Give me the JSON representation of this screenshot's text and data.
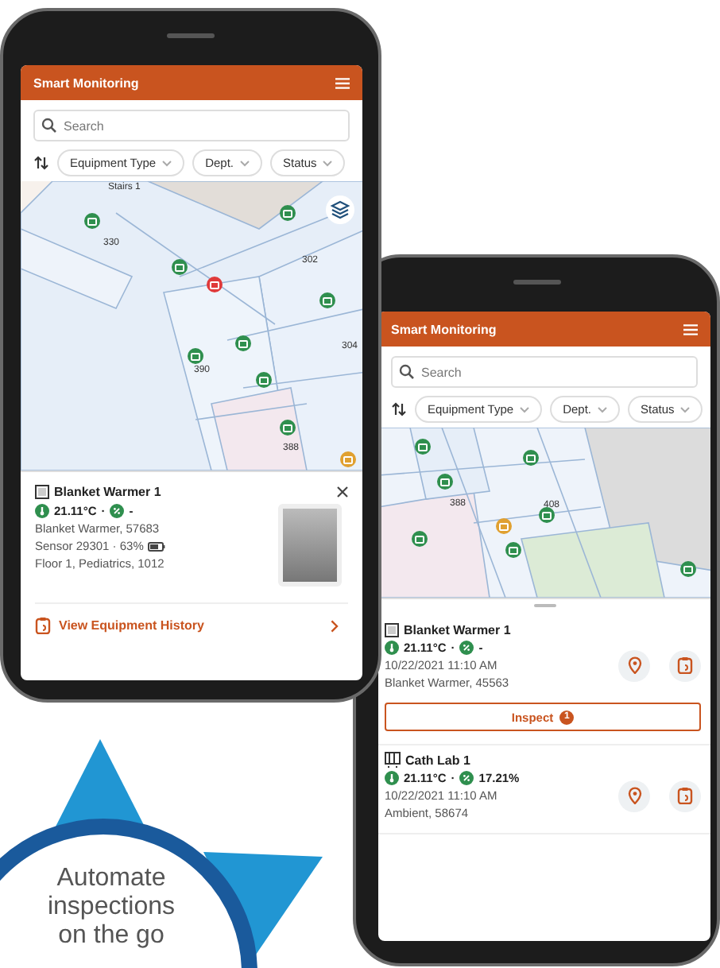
{
  "phones": [
    {
      "app_title": "Smart Monitoring",
      "search": {
        "placeholder": "Search"
      },
      "filters": [
        "Equipment Type",
        "Dept.",
        "Status"
      ],
      "map": {
        "labels": [
          "Stairs 1",
          "330",
          "302",
          "304",
          "390",
          "388"
        ],
        "markers": [
          {
            "color": "#2f8f4e"
          },
          {
            "color": "#2f8f4e"
          },
          {
            "color": "#2f8f4e"
          },
          {
            "color": "#e03a3a"
          },
          {
            "color": "#2f8f4e"
          },
          {
            "color": "#2f8f4e"
          },
          {
            "color": "#2f8f4e"
          },
          {
            "color": "#2f8f4e"
          },
          {
            "color": "#2f8f4e"
          },
          {
            "color": "#e0a030"
          }
        ]
      },
      "detail_card": {
        "name": "Blanket Warmer 1",
        "temperature": "21.11°C",
        "separator": "·",
        "humidity": "-",
        "lines": [
          {
            "kind": "plain",
            "text": "Blanket Warmer, 57683"
          },
          {
            "kind": "battery",
            "text": "Sensor 29301 · 63%"
          },
          {
            "kind": "plain",
            "text": "Floor 1, Pediatrics, 1012"
          }
        ],
        "link": "View Equipment History"
      }
    },
    {
      "app_title": "Smart Monitoring",
      "search": {
        "placeholder": "Search"
      },
      "filters": [
        "Equipment Type",
        "Dept.",
        "Status"
      ],
      "map": {
        "labels": [
          "388",
          "408"
        ],
        "markers": [
          {
            "color": "#2f8f4e"
          },
          {
            "color": "#2f8f4e"
          },
          {
            "color": "#2f8f4e"
          },
          {
            "color": "#2f8f4e"
          },
          {
            "color": "#e0a030"
          },
          {
            "color": "#2f8f4e"
          },
          {
            "color": "#2f8f4e"
          },
          {
            "color": "#2f8f4e"
          }
        ]
      },
      "list": [
        {
          "name": "Blanket Warmer 1",
          "temperature": "21.11°C",
          "separator": "·",
          "humidity": "-",
          "time": "10/22/2021 11:10 AM",
          "description": "Blanket Warmer, 45563",
          "inspect": {
            "label": "Inspect",
            "count": "1"
          }
        },
        {
          "name": "Cath Lab 1",
          "temperature": "21.11°C",
          "separator": "·",
          "humidity": "17.21%",
          "time": "10/22/2021 11:10 AM",
          "description": "Ambient, 58674"
        }
      ]
    }
  ],
  "badge": {
    "lines": [
      "Automate",
      "inspections",
      "on the go"
    ]
  }
}
